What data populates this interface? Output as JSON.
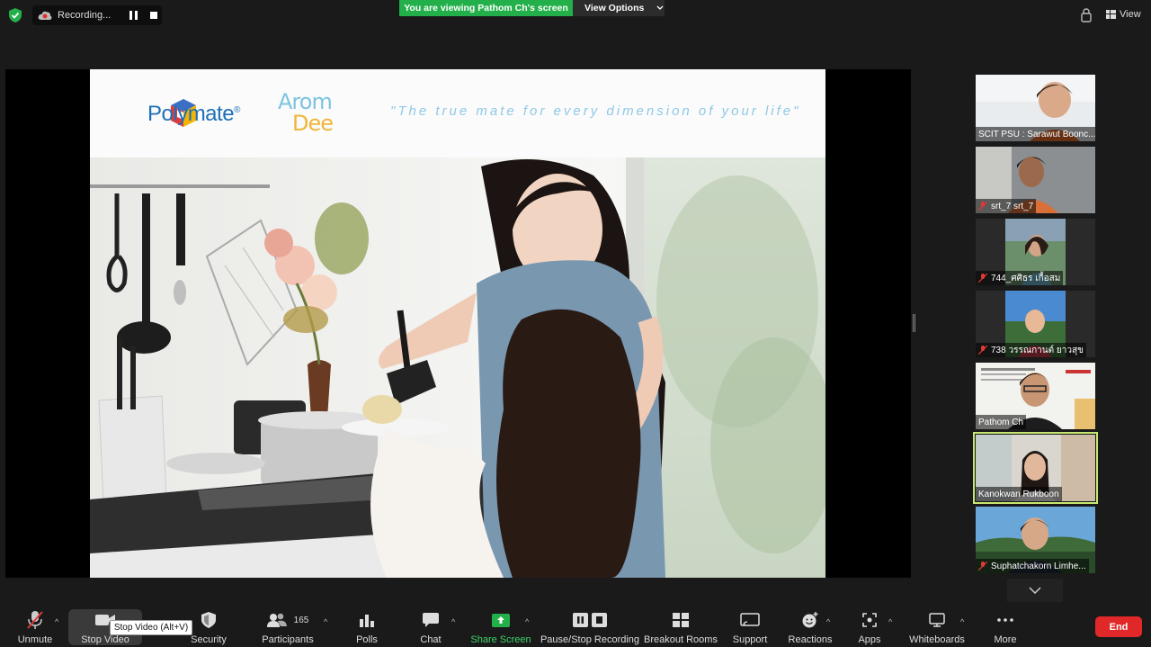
{
  "recording": {
    "label": "Recording..."
  },
  "banner": {
    "viewing": "You are viewing Pathom Ch's screen",
    "view_options": "View Options"
  },
  "topright": {
    "view_label": "View"
  },
  "slide": {
    "brand": "Polymate",
    "brand_mark": "®",
    "logo2_line1": "Arom",
    "logo2_line2": "Dee",
    "tagline": "\"The true mate for every dimension of your life\""
  },
  "participants": [
    {
      "name": "SCIT PSU : Sarawut Boonc...",
      "muted": false
    },
    {
      "name": "srt_7 srt_7",
      "muted": true
    },
    {
      "name": "744_ศศิธร เกื้อสม",
      "muted": true
    },
    {
      "name": "738 วรรณกานต์ ยาวสุข",
      "muted": true
    },
    {
      "name": "Pathom Ch",
      "muted": false
    },
    {
      "name": "Kanokwan Rukboon",
      "muted": false,
      "active": true
    },
    {
      "name": "Suphatchakorn Limhe...",
      "muted": true
    }
  ],
  "toolbar": {
    "unmute": "Unmute",
    "stop_video": "Stop Video",
    "security": "Security",
    "participants": "Participants",
    "participants_count": "165",
    "polls": "Polls",
    "chat": "Chat",
    "share_screen": "Share Screen",
    "pause_stop_recording": "Pause/Stop Recording",
    "breakout_rooms": "Breakout Rooms",
    "support": "Support",
    "reactions": "Reactions",
    "apps": "Apps",
    "whiteboards": "Whiteboards",
    "more": "More",
    "end": "End",
    "tooltip": "Stop Video (Alt+V)"
  },
  "colors": {
    "share_green": "#23b04a",
    "end_red": "#e02828",
    "active_border": "#c7e870"
  }
}
